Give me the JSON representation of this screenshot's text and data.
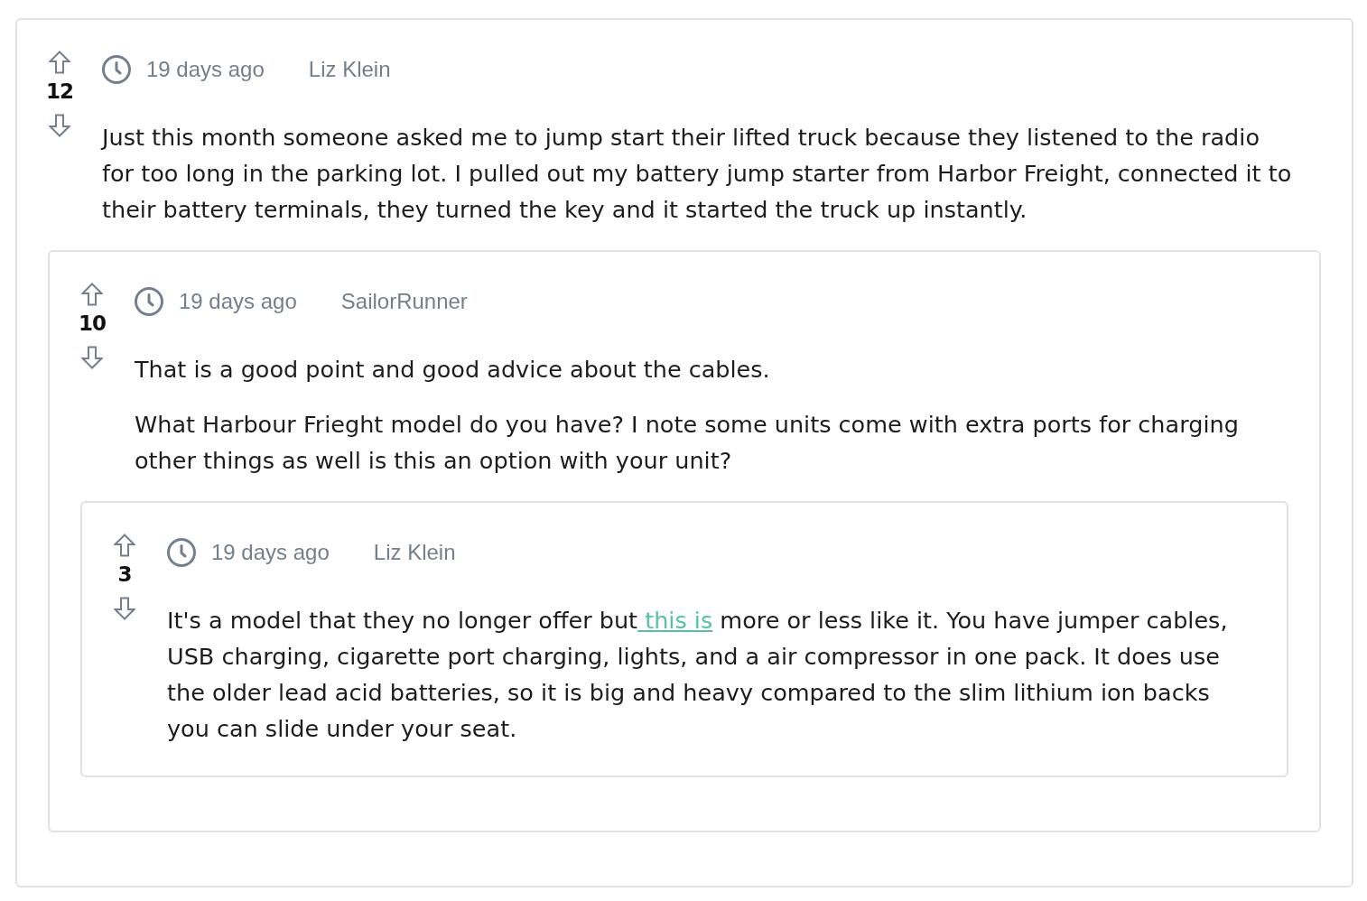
{
  "comments": [
    {
      "votes": "12",
      "time": "19 days ago",
      "author": "Liz Klein",
      "paragraphs": [
        [
          {
            "kind": "text",
            "text": "Just this month someone asked me to jump start their lifted truck because they listened to the radio for too long in the parking lot. I pulled out my battery jump starter from Harbor Freight, connected it to their battery terminals, they turned the key and it started the truck up instantly."
          }
        ]
      ],
      "replies": [
        {
          "votes": "10",
          "time": "19 days ago",
          "author": "SailorRunner",
          "paragraphs": [
            [
              {
                "kind": "text",
                "text": "That is a good point and good advice about the cables."
              }
            ],
            [
              {
                "kind": "text",
                "text": "What Harbour Frieght model do you have? I note some units come with extra ports for charging other things as well is this an option with your unit?"
              }
            ]
          ],
          "replies": [
            {
              "votes": "3",
              "time": "19 days ago",
              "author": "Liz Klein",
              "paragraphs": [
                [
                  {
                    "kind": "text",
                    "text": "It's a model that they no longer offer but"
                  },
                  {
                    "kind": "link",
                    "text": " this is"
                  },
                  {
                    "kind": "text",
                    "text": " more or less like it. You have jumper cables, USB charging, cigarette port charging, lights, and a air compressor in one pack. It does use the older lead acid batteries, so it is big and heavy compared to the slim lithium ion backs you can slide under your seat."
                  }
                ]
              ]
            }
          ]
        }
      ]
    }
  ]
}
